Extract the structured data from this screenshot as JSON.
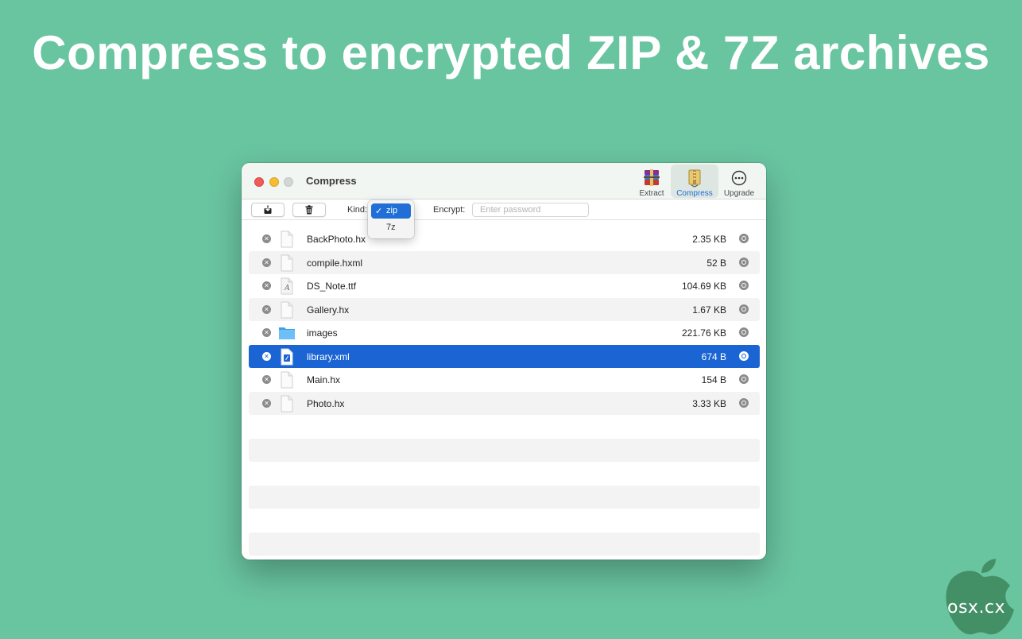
{
  "headline": "Compress to encrypted ZIP & 7Z archives",
  "window": {
    "title": "Compress"
  },
  "toolbar": {
    "items": [
      {
        "label": "Extract",
        "icon": "winrar-books-icon",
        "active": false
      },
      {
        "label": "Compress",
        "icon": "compress-archive-icon",
        "active": true
      },
      {
        "label": "Upgrade",
        "icon": "ellipsis-circle-icon",
        "active": false
      }
    ]
  },
  "options": {
    "kind_label": "Kind:",
    "encrypt_label": "Encrypt:",
    "password_placeholder": "Enter password",
    "password_value": "",
    "kind_options": [
      {
        "label": "zip",
        "selected": true
      },
      {
        "label": "7z",
        "selected": false
      }
    ],
    "check_mark": "✓"
  },
  "files": [
    {
      "name": "BackPhoto.hx",
      "size": "2.35 KB",
      "icon": "document-icon"
    },
    {
      "name": "compile.hxml",
      "size": "52 B",
      "icon": "document-icon"
    },
    {
      "name": "DS_Note.ttf",
      "size": "104.69 KB",
      "icon": "font-file-icon"
    },
    {
      "name": "Gallery.hx",
      "size": "1.67 KB",
      "icon": "document-icon"
    },
    {
      "name": "images",
      "size": "221.76 KB",
      "icon": "folder-icon"
    },
    {
      "name": "library.xml",
      "size": "674 B",
      "icon": "xml-file-icon",
      "selected": true
    },
    {
      "name": "Main.hx",
      "size": "154 B",
      "icon": "document-icon"
    },
    {
      "name": "Photo.hx",
      "size": "3.33 KB",
      "icon": "document-icon"
    }
  ],
  "watermark": {
    "text": "osx.cx"
  },
  "colors": {
    "background": "#69c4a0",
    "accent": "#1b64d3",
    "titlebar": "#f1f6f3"
  }
}
